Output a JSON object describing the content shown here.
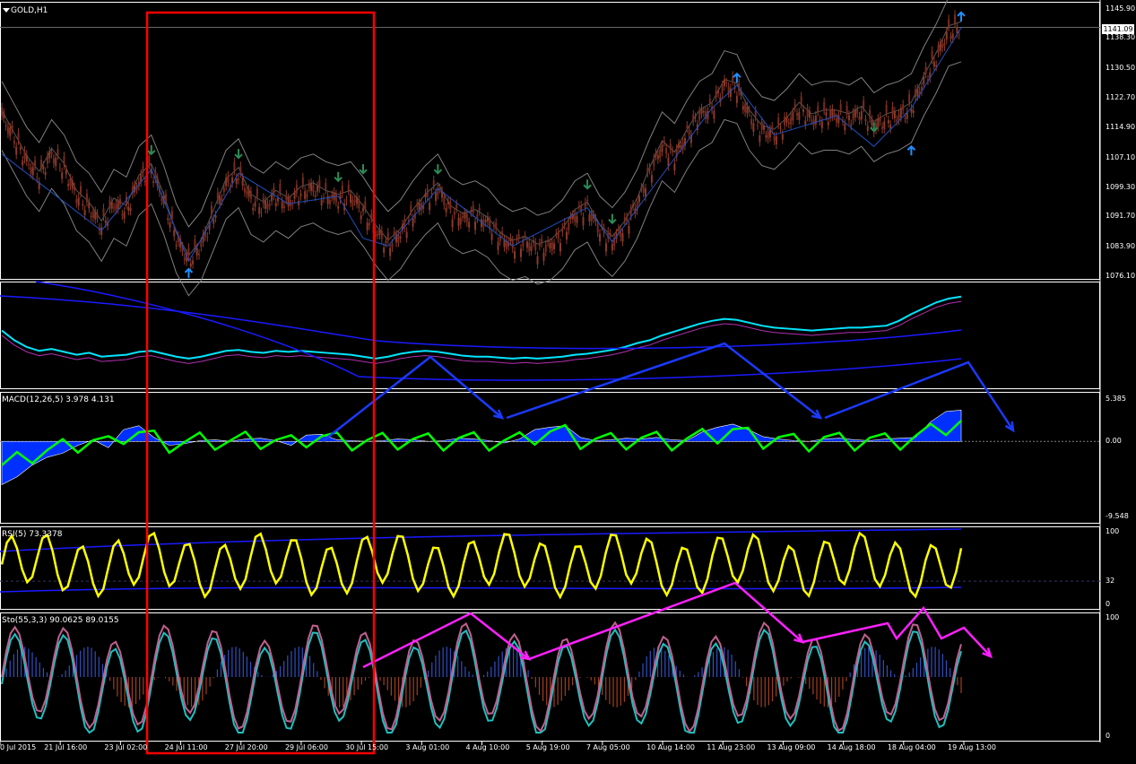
{
  "chart_data": {
    "type": "line",
    "symbol": "GOLD,H1",
    "colors": {
      "background": "#000000",
      "frame": "#ffffff",
      "bull": "#8b3a2a",
      "bear": "#7a2a20",
      "bands": "#808080",
      "zigzag": "#1f4fbf",
      "up_arrow": "#1e90ff",
      "down_arrow": "#2e8b57",
      "price_line": "#00e5ff",
      "ma": "#1a1aff",
      "macd_hist": "#0030ff",
      "macd_line": "#00ff00",
      "rsi_line": "#ffff00",
      "rsi_dot": "#ff00ff",
      "sto_main": "#c06090",
      "sto_sig": "#20c0c0",
      "annot_blue": "#1a3aff",
      "annot_magenta": "#ff20ff",
      "highlight": "#ff0000"
    },
    "price_panel": {
      "y_ticks": [
        "1145.90",
        "1138.30",
        "1130.50",
        "1122.70",
        "1114.90",
        "1107.10",
        "1099.30",
        "1091.70",
        "1083.90",
        "1076.10"
      ],
      "ylim": [
        1076.1,
        1145.9
      ],
      "current_price": "1141.09",
      "close_series": [
        1118,
        1112,
        1106,
        1102,
        1108,
        1104,
        1097,
        1094,
        1089,
        1095,
        1093,
        1101,
        1104,
        1096,
        1086,
        1080,
        1084,
        1092,
        1100,
        1103,
        1096,
        1094,
        1097,
        1095,
        1098,
        1099,
        1097,
        1096,
        1097,
        1093,
        1088,
        1084,
        1087,
        1092,
        1096,
        1099,
        1093,
        1091,
        1092,
        1090,
        1086,
        1084,
        1085,
        1083,
        1084,
        1087,
        1092,
        1094,
        1088,
        1085,
        1089,
        1095,
        1103,
        1110,
        1107,
        1113,
        1118,
        1120,
        1126,
        1125,
        1118,
        1114,
        1113,
        1116,
        1120,
        1117,
        1118,
        1118,
        1117,
        1119,
        1115,
        1117,
        1118,
        1120,
        1127,
        1133,
        1140,
        1141.09
      ]
    },
    "panel2": {
      "label": "",
      "series": [
        0.45,
        0.55,
        0.62,
        0.66,
        0.64,
        0.67,
        0.7,
        0.68,
        0.72,
        0.71,
        0.7,
        0.67,
        0.66,
        0.69,
        0.72,
        0.74,
        0.72,
        0.69,
        0.66,
        0.65,
        0.67,
        0.68,
        0.66,
        0.67,
        0.66,
        0.67,
        0.68,
        0.69,
        0.7,
        0.72,
        0.74,
        0.72,
        0.69,
        0.67,
        0.66,
        0.67,
        0.69,
        0.71,
        0.72,
        0.72,
        0.73,
        0.74,
        0.73,
        0.74,
        0.73,
        0.72,
        0.7,
        0.69,
        0.67,
        0.65,
        0.62,
        0.58,
        0.55,
        0.5,
        0.46,
        0.42,
        0.38,
        0.35,
        0.33,
        0.34,
        0.37,
        0.4,
        0.42,
        0.43,
        0.44,
        0.45,
        0.44,
        0.43,
        0.42,
        0.42,
        0.41,
        0.4,
        0.35,
        0.28,
        0.22,
        0.16,
        0.12,
        0.1
      ]
    },
    "macd_panel": {
      "label": "MACD(12,26,5) 3.978 4.131",
      "y_ticks": [
        "5.385",
        "0.00",
        "-9.548"
      ],
      "ylim": [
        -9.548,
        5.385
      ],
      "hist_series": [
        -5.5,
        -4.5,
        -3.0,
        -2.0,
        -1.5,
        -0.5,
        0.2,
        -0.8,
        1.5,
        2.0,
        0.5,
        -0.5,
        -0.3,
        0.1,
        0.2,
        0.0,
        0.3,
        0.4,
        0.1,
        -0.5,
        0.8,
        0.9,
        0.2,
        0.1,
        0.0,
        0.1,
        0.3,
        0.2,
        0.0,
        0.1,
        0.4,
        0.3,
        0.1,
        -0.2,
        0.3,
        1.5,
        1.8,
        2.0,
        0.5,
        0.1,
        0.2,
        0.4,
        0.3,
        0.5,
        0.2,
        0.1,
        1.2,
        1.8,
        2.2,
        1.5,
        0.6,
        0.3,
        0.1,
        0.0,
        0.3,
        0.4,
        0.2,
        0.1,
        0.3,
        0.4,
        0.5,
        2.5,
        3.8,
        3.978
      ]
    },
    "rsi_panel": {
      "label": "RSI(5) 73.3378",
      "y_ticks": [
        "100",
        "32",
        "0"
      ],
      "ylim": [
        0,
        100
      ],
      "level": 32
    },
    "sto_panel": {
      "label": "Sto(55,3,3) 90.0625 89.0155",
      "y_ticks": [
        "100",
        "0"
      ],
      "ylim": [
        0,
        100
      ]
    },
    "x_ticks": [
      "0 Jul 2015",
      "21 Jul 16:00",
      "23 Jul 02:00",
      "24 Jul 11:00",
      "27 Jul 20:00",
      "29 Jul 06:00",
      "30 Jul 15:00",
      "3 Aug 01:00",
      "4 Aug 10:00",
      "5 Aug 19:00",
      "7 Aug 05:00",
      "10 Aug 14:00",
      "11 Aug 23:00",
      "13 Aug 09:00",
      "14 Aug 18:00",
      "18 Aug 04:00",
      "19 Aug 13:00"
    ]
  }
}
